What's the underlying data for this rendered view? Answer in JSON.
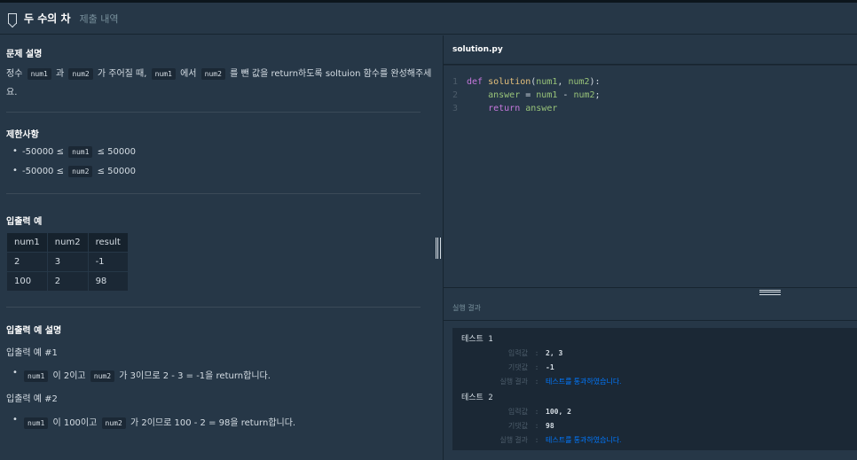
{
  "header": {
    "title": "두 수의 차",
    "tab_history": "제출 내역"
  },
  "problem": {
    "heading": "문제 설명",
    "desc_1": "정수",
    "var_a": "num1",
    "desc_2": "과",
    "var_b": "num2",
    "desc_3": "가 주어질 때,",
    "desc_4": "에서",
    "desc_5": "를 뺀 값을 return하도록 soltuion 함수를 완성해주세",
    "desc_6": "요."
  },
  "constraints": {
    "heading": "제한사항",
    "items": [
      {
        "pre": "-50000 ≤",
        "var": "num1",
        "post": "≤ 50000"
      },
      {
        "pre": "-50000 ≤",
        "var": "num2",
        "post": "≤ 50000"
      }
    ]
  },
  "io_example": {
    "heading": "입출력 예",
    "columns": [
      "num1",
      "num2",
      "result"
    ],
    "rows": [
      [
        "2",
        "3",
        "-1"
      ],
      [
        "100",
        "2",
        "98"
      ]
    ]
  },
  "io_explanation": {
    "heading": "입출력 예 설명",
    "ex1_title": "입출력 예 #1",
    "ex1_var_a": "num1",
    "ex1_text_a": "이 2이고",
    "ex1_var_b": "num2",
    "ex1_text_b": "가 3이므로 2 - 3 = -1을 return합니다.",
    "ex2_title": "입출력 예 #2",
    "ex2_var_a": "num1",
    "ex2_text_a": "이 100이고",
    "ex2_var_b": "num2",
    "ex2_text_b": "가 2이므로 100 - 2 = 98을 return합니다."
  },
  "editor": {
    "filename": "solution.py",
    "line_numbers": [
      "1",
      "2",
      "3"
    ],
    "l1_kw": "def",
    "l1_fn": "solution",
    "l1_open": "(",
    "l1_p1": "num1",
    "l1_comma": ", ",
    "l1_p2": "num2",
    "l1_close": "):",
    "l2_var": "answer",
    "l2_op": " = ",
    "l2_a": "num1",
    "l2_minus": " - ",
    "l2_b": "num2",
    "l2_end": ";",
    "l3_kw": "return",
    "l3_var": "answer"
  },
  "results": {
    "heading": "실행 결과",
    "tests": [
      {
        "name": "테스트 1",
        "input_label": "입력값",
        "input": "2, 3",
        "expected_label": "기댓값",
        "expected": "-1",
        "result_label": "실행 결과",
        "result": "테스트를 통과하였습니다."
      },
      {
        "name": "테스트 2",
        "input_label": "입력값",
        "input": "100, 2",
        "expected_label": "기댓값",
        "expected": "98",
        "result_label": "실행 결과",
        "result": "테스트를 통과하였습니다."
      }
    ],
    "colon": ":"
  }
}
